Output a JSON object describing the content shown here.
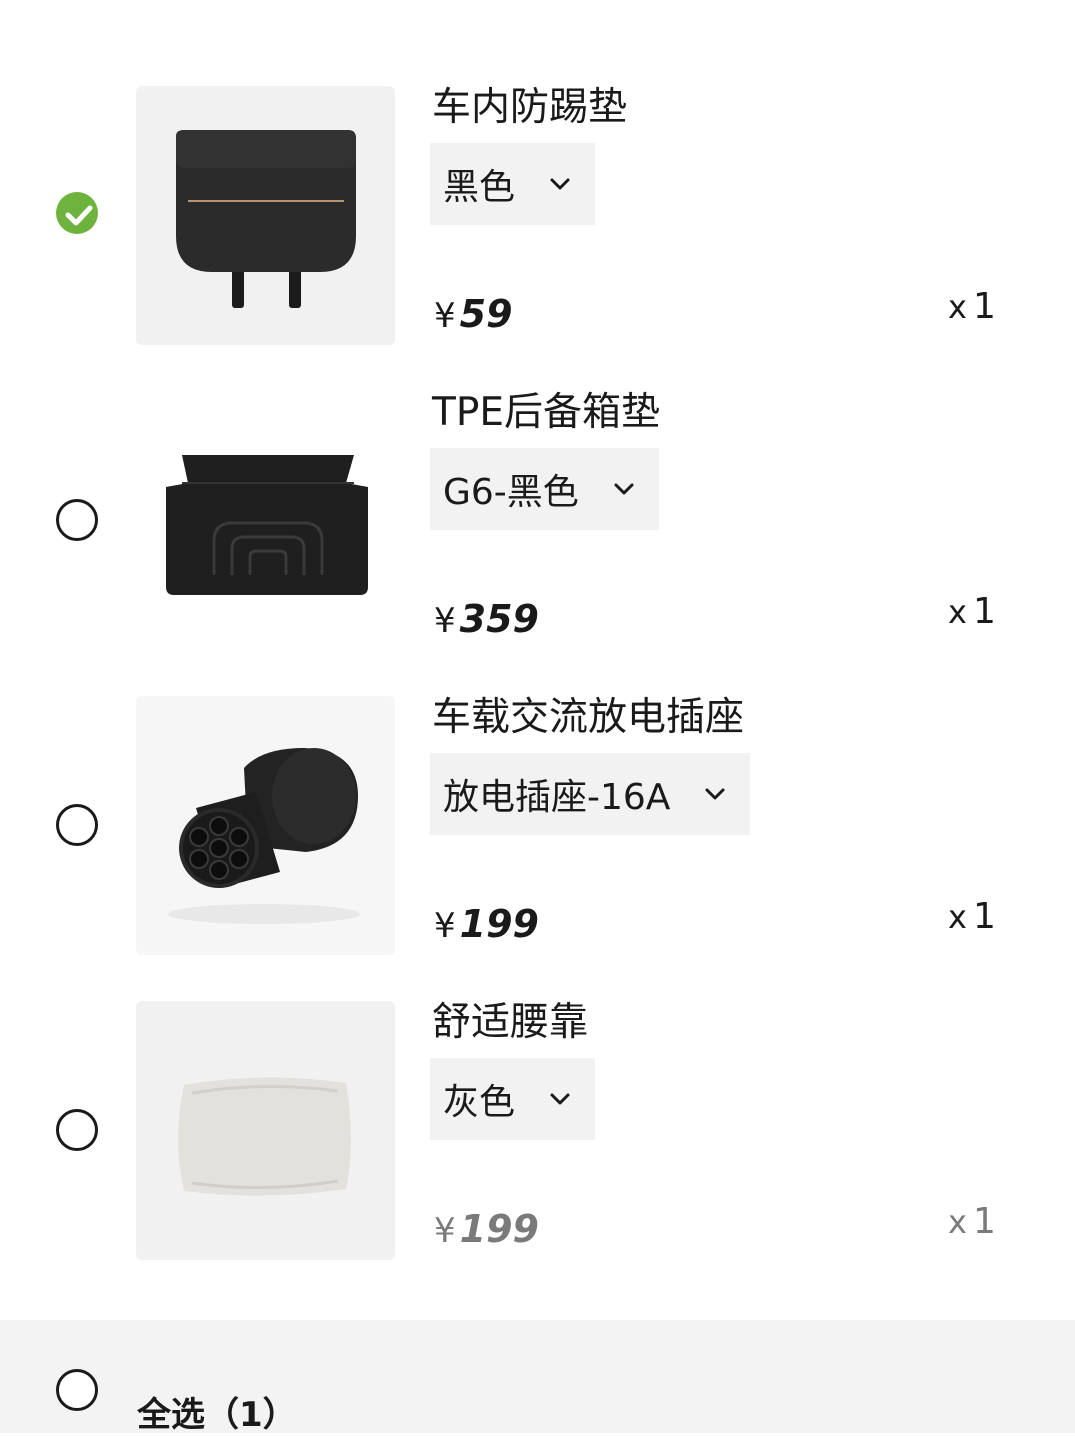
{
  "items": [
    {
      "title": "车内防踢垫",
      "variant": "黑色",
      "currency": "¥",
      "price": "59",
      "qty_prefix": "x",
      "qty": "1",
      "selected": true
    },
    {
      "title": "TPE后备箱垫",
      "variant": "G6-黑色",
      "currency": "¥",
      "price": "359",
      "qty_prefix": "x",
      "qty": "1",
      "selected": false
    },
    {
      "title": "车载交流放电插座",
      "variant": "放电插座-16A",
      "currency": "¥",
      "price": "199",
      "qty_prefix": "x",
      "qty": "1",
      "selected": false
    },
    {
      "title": "舒适腰靠",
      "variant": "灰色",
      "currency": "¥",
      "price": "199",
      "qty_prefix": "x",
      "qty": "1",
      "selected": false
    }
  ],
  "footer": {
    "select_all_label": "全选（1）"
  },
  "colors": {
    "check_green": "#6fb33f",
    "footer_bg": "#f3f3f3",
    "variant_bg": "#f2f2f2"
  },
  "icons": {
    "selected": "check-circle-icon",
    "unselected": "radio-empty-icon",
    "dropdown": "chevron-down-icon"
  }
}
